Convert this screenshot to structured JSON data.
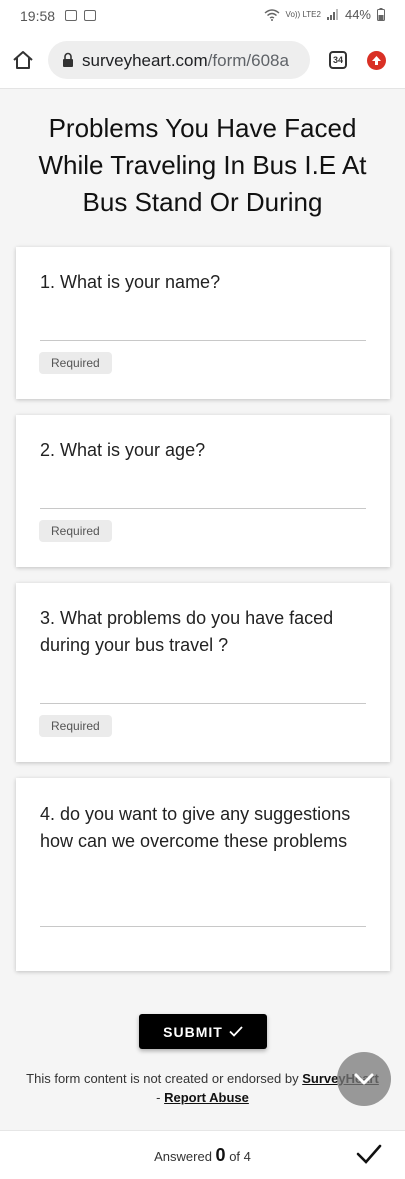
{
  "status_bar": {
    "time": "19:58",
    "network": "Vo)) LTE2",
    "battery": "44%"
  },
  "browser": {
    "url_main": "surveyheart.com",
    "url_path": "/form/608a",
    "tab_count": "34"
  },
  "form": {
    "title": "Problems You Have Faced While Traveling In Bus I.E At Bus Stand Or During",
    "questions": [
      {
        "text": "1. What is your name?",
        "required": "Required"
      },
      {
        "text": "2. What is your age?",
        "required": "Required"
      },
      {
        "text": "3. What problems do you have faced during your bus travel ?",
        "required": "Required"
      },
      {
        "text": "4. do you want to give any suggestions how can we overcome these problems"
      }
    ],
    "submit_label": "SUBMIT"
  },
  "footer": {
    "text": "This form content is not created or endorsed by",
    "brand_link": "SurveyHeart",
    "separator": "-",
    "report_link": "Report Abuse"
  },
  "bottom_bar": {
    "answered_label": "Answered",
    "answered_count": "0",
    "of_label": "of",
    "total": "4"
  },
  "colors": {
    "submit_bg": "#000000",
    "update_badge": "#d93025",
    "card_bg": "#ffffff",
    "page_bg": "#f5f5f5"
  },
  "icons": [
    "home-icon",
    "lock-icon",
    "tab-switcher-icon",
    "update-icon",
    "checkmark-icon",
    "chevron-down-icon"
  ]
}
